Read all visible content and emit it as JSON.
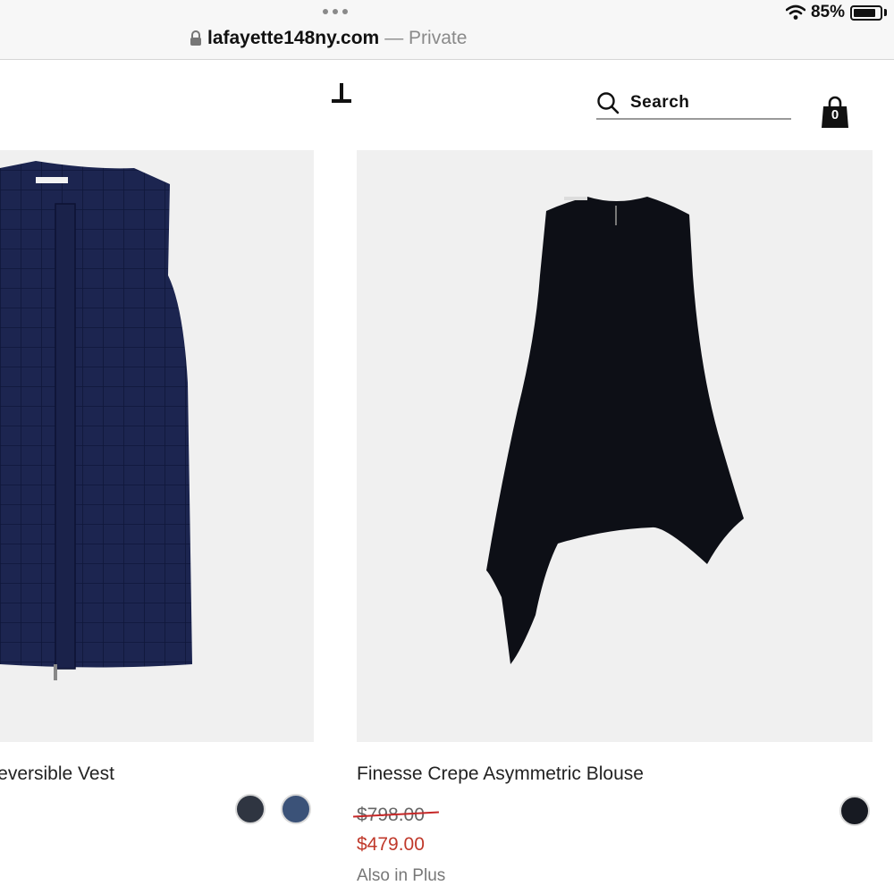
{
  "browser": {
    "battery_percent": "85%",
    "battery_level": 0.85,
    "url": "lafayette148ny.com",
    "private_label": "— Private",
    "icons": [
      "more-dots-icon",
      "wifi-icon",
      "battery-icon",
      "lock-icon"
    ]
  },
  "header": {
    "logo_glyph": "L",
    "search_label": "Search",
    "cart_count": "0",
    "icons": [
      "search-icon",
      "shopping-bag-icon"
    ]
  },
  "products": [
    {
      "name": "Reversible Vest",
      "image": "navy quilted vest",
      "swatches": [
        "#2f3541",
        "#3b5278"
      ]
    },
    {
      "name": "Finesse Crepe Asymmetric Blouse",
      "image": "black asymmetric blouse",
      "price_original": "$798.00",
      "price_sale": "$479.00",
      "also_in": "Also in Plus",
      "swatches": [
        "#171a22"
      ]
    }
  ],
  "colors": {
    "sale_price": "#c0392b",
    "card_background": "#f0f0f0"
  }
}
